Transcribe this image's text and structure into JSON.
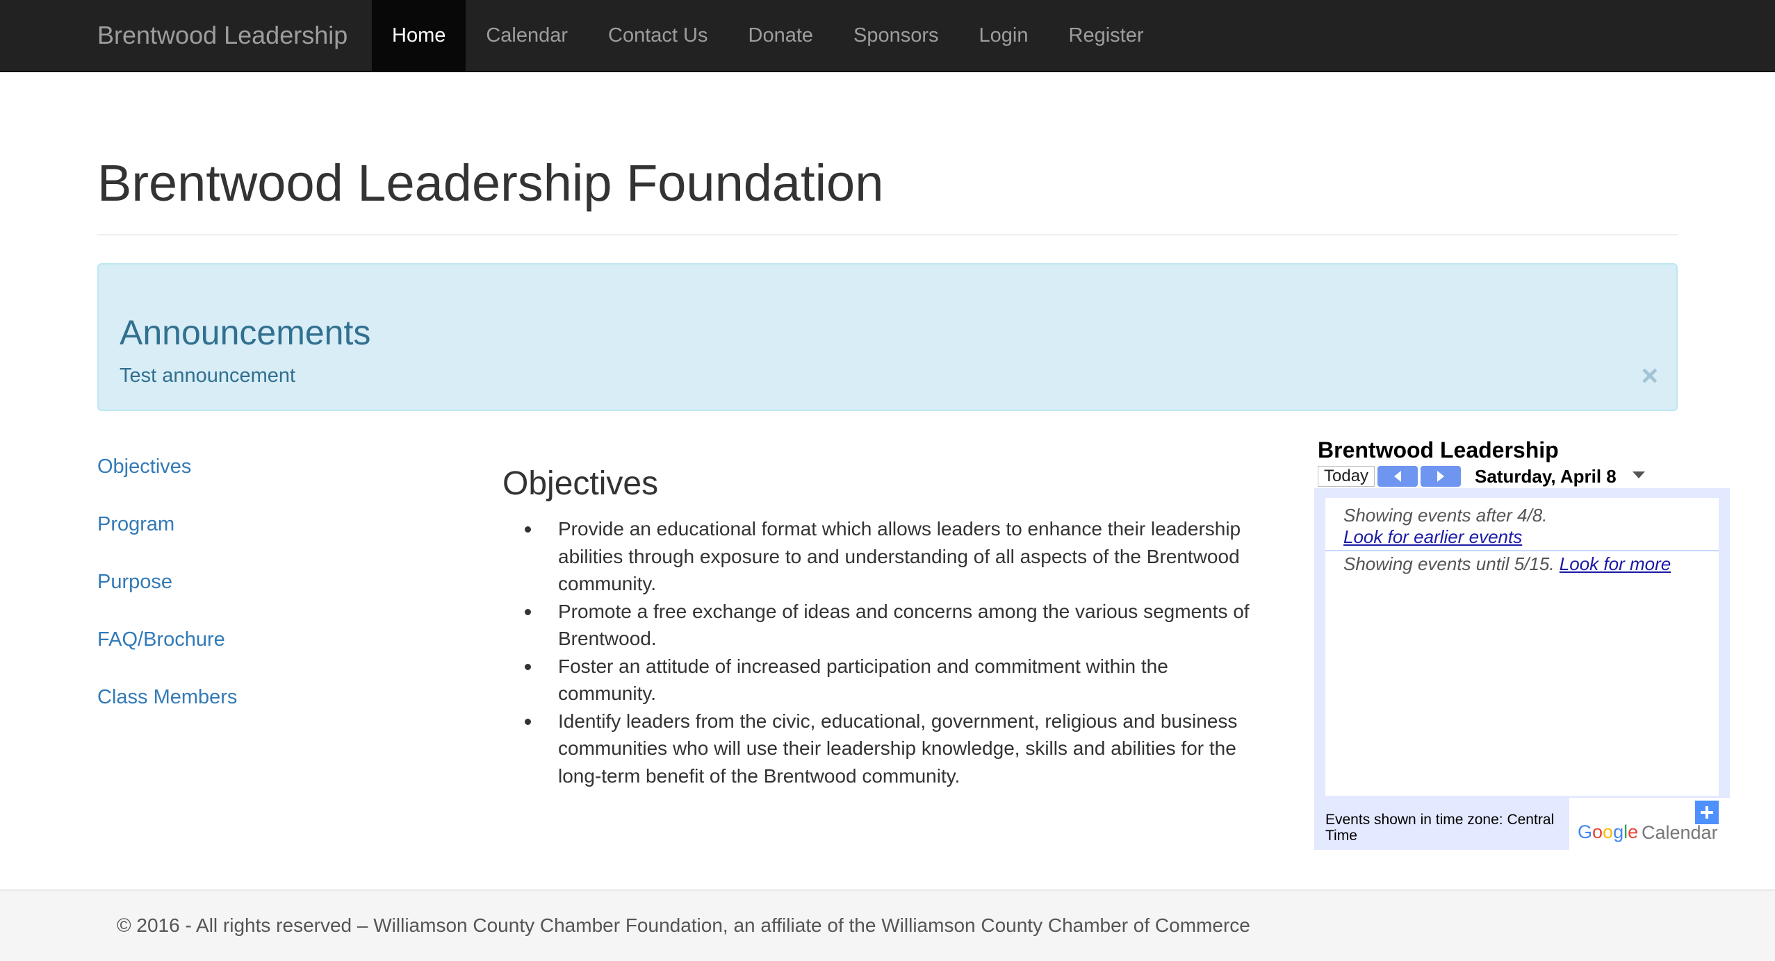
{
  "navbar": {
    "brand": "Brentwood Leadership",
    "items": [
      {
        "label": "Home",
        "active": true
      },
      {
        "label": "Calendar"
      },
      {
        "label": "Contact Us"
      },
      {
        "label": "Donate"
      },
      {
        "label": "Sponsors"
      },
      {
        "label": "Login"
      },
      {
        "label": "Register"
      }
    ]
  },
  "page": {
    "title": "Brentwood Leadership Foundation"
  },
  "announcement": {
    "heading": "Announcements",
    "text": "Test announcement",
    "close_symbol": "×"
  },
  "side_nav": {
    "items": [
      "Objectives",
      "Program",
      "Purpose",
      "FAQ/Brochure",
      "Class Members"
    ]
  },
  "content": {
    "heading": "Objectives",
    "objectives": [
      "Provide an educational format which allows leaders to enhance their leadership abilities through exposure to and understanding of all aspects of the Brentwood community.",
      "Promote a free exchange of ideas and concerns among the various segments of Brentwood.",
      "Foster an attitude of increased participation and commitment within the community.",
      "Identify leaders from the civic, educational, government, religious and business communities who will use their leadership knowledge, skills and abilities for the long-term benefit of the Brentwood community."
    ]
  },
  "calendar": {
    "title": "Brentwood Leadership",
    "today_label": "Today",
    "date": "Saturday, April 8",
    "showing_after": "Showing events after 4/8.",
    "earlier_link": "Look for earlier events",
    "showing_until": "Showing events until 5/15.",
    "more_link": "Look for more",
    "timezone": "Events shown in time zone: Central Time",
    "logo_calendar": "Calendar",
    "icons": [
      "chevron-left-icon",
      "chevron-right-icon",
      "dropdown-triangle-icon",
      "plus-icon"
    ],
    "colors": {
      "frame": "#e3e9ff",
      "arrow_button": "#6e96f1",
      "plus_button": "#4d90fe",
      "link": "#1a1aa6"
    }
  },
  "footer": {
    "text": "© 2016 - All rights reserved – Williamson County Chamber Foundation, an affiliate of the Williamson County Chamber of Commerce"
  },
  "colors": {
    "navbar_bg": "#222222",
    "link": "#337ab7",
    "alert_bg": "#d9edf7",
    "alert_text": "#31708f"
  }
}
